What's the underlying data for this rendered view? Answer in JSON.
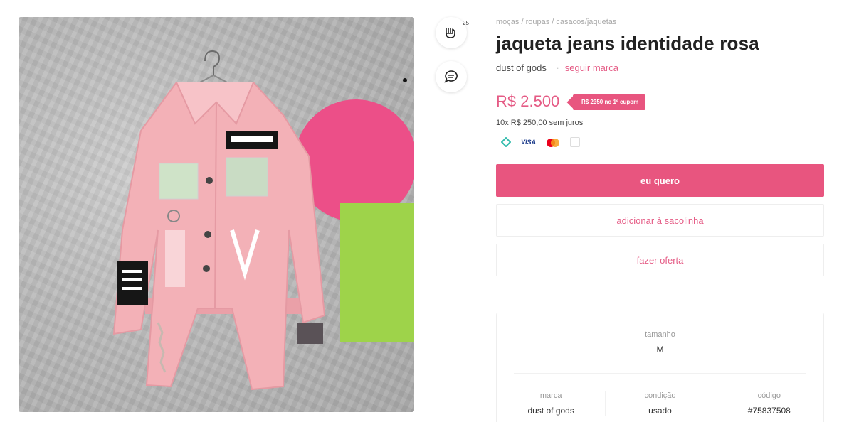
{
  "colors": {
    "accent": "#e8557f",
    "accent_text": "#e55b85",
    "wall": "#b9b9b9",
    "jacket": "#f3b1b7",
    "pink_disc": "#ec4f88",
    "green_board": "#9ed34a"
  },
  "gallery": {
    "image_alt": "jaqueta jeans identidade rosa"
  },
  "actions": {
    "like_icon": "heart-hand-icon",
    "like_count": "25",
    "chat_icon": "chat-bubble-icon"
  },
  "breadcrumb": [
    "moças",
    "roupas",
    "casacos/jaquetas"
  ],
  "breadcrumb_separator": "/",
  "product": {
    "title": "jaqueta jeans identidade rosa",
    "brand": "dust of gods",
    "follow_label": "seguir marca",
    "price": "R$ 2.500",
    "coupon": "R$ 2350 no 1º cupom",
    "installments": "10x R$ 250,00 sem juros"
  },
  "payment_icons": [
    "pix-icon",
    "visa-icon",
    "mastercard-icon",
    "card-icon"
  ],
  "payment_text": {
    "visa": "VISA"
  },
  "buttons": {
    "buy": "eu quero",
    "add_to_bag": "adicionar à sacolinha",
    "offer": "fazer oferta"
  },
  "attributes": {
    "size_label": "tamanho",
    "size_value": "M",
    "brand_label": "marca",
    "brand_value": "dust of gods",
    "condition_label": "condição",
    "condition_value": "usado",
    "code_label": "código",
    "code_value": "#75837508"
  }
}
